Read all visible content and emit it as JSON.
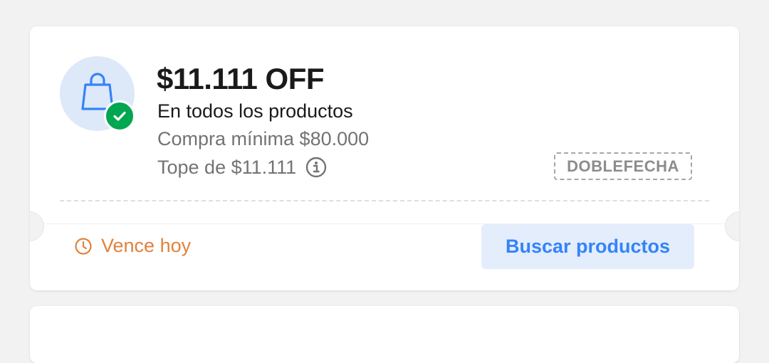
{
  "coupon": {
    "title": "$11.111 OFF",
    "subtitle": "En todos los productos",
    "minimum": "Compra mínima $80.000",
    "cap": "Tope de $11.111",
    "code": "DOBLEFECHA",
    "expiry": "Vence hoy",
    "action_label": "Buscar productos",
    "icons": {
      "main": "shopping-bag-icon",
      "badge": "check-icon",
      "info": "info-icon",
      "expiry": "clock-icon"
    },
    "colors": {
      "primary": "#3483fa",
      "success": "#00a650",
      "warning": "#e0823d"
    }
  }
}
